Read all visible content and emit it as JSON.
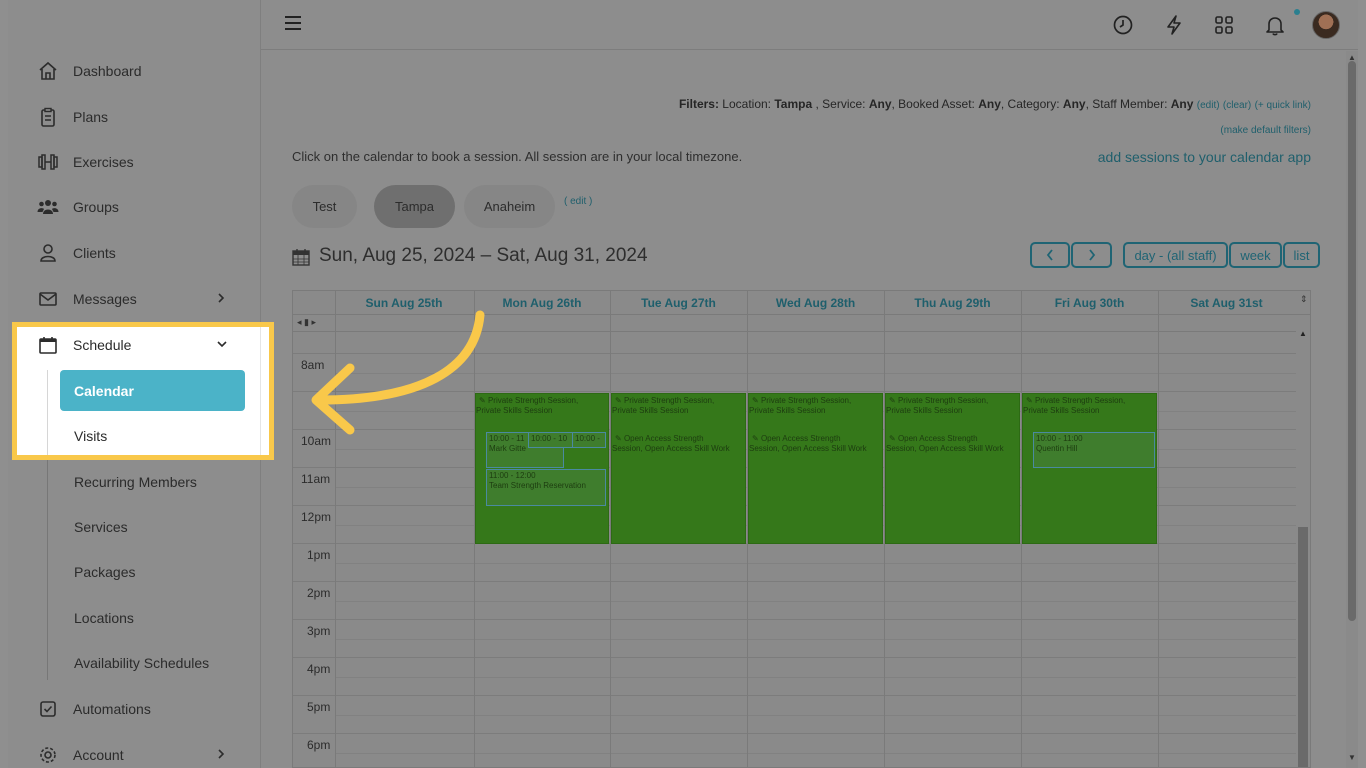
{
  "sidebar": {
    "items": [
      {
        "label": "Dashboard",
        "icon": "home-icon"
      },
      {
        "label": "Plans",
        "icon": "clipboard-icon"
      },
      {
        "label": "Exercises",
        "icon": "dumbbell-icon"
      },
      {
        "label": "Groups",
        "icon": "users-icon"
      },
      {
        "label": "Clients",
        "icon": "user-icon"
      },
      {
        "label": "Messages",
        "icon": "mail-icon"
      },
      {
        "label": "Schedule",
        "icon": "calendar-icon"
      },
      {
        "label": "Automations",
        "icon": "check-square-icon"
      },
      {
        "label": "Account",
        "icon": "gear-icon"
      }
    ],
    "schedule_sub": [
      "Calendar",
      "Visits",
      "Recurring Members",
      "Services",
      "Packages",
      "Locations",
      "Availability Schedules"
    ]
  },
  "filters": {
    "label": "Filters:",
    "location_label": " Location: ",
    "location_value": "Tampa",
    "service_label": " , Service: ",
    "service_value": "Any",
    "asset_label": ", Booked Asset: ",
    "asset_value": "Any",
    "category_label": ", Category: ",
    "category_value": "Any",
    "staff_label": ", Staff Member: ",
    "staff_value": "Any",
    "edit": "(edit)",
    "clear": "(clear)",
    "quick": "(+ quick link)",
    "make_default": "(make default filters)"
  },
  "info_line": "Click on the calendar to book a session. All session are in your local timezone.",
  "add_sessions": "add sessions to your calendar app",
  "locations": [
    "Test",
    "Tampa",
    "Anaheim"
  ],
  "locations_edit": "( edit )",
  "date_range": "Sun, Aug 25, 2024 – Sat, Aug 31, 2024",
  "buttons": {
    "prev": "‹",
    "next": "›",
    "day": "day - (all staff)",
    "week": "week",
    "list": "list"
  },
  "days": [
    "Sun Aug 25th",
    "Mon Aug 26th",
    "Tue Aug 27th",
    "Wed Aug 28th",
    "Thu Aug 29th",
    "Fri Aug 30th",
    "Sat Aug 31st"
  ],
  "hours": [
    "8am",
    "9am",
    "10am",
    "11am",
    "12pm",
    "1pm",
    "2pm",
    "3pm",
    "4pm",
    "5pm",
    "6pm"
  ],
  "events": {
    "private": "Private Strength Session, Private Skills Session",
    "private_a": "Private Strength Session,",
    "private_b": "Private Skills Session",
    "open_a": "Open Access Strength",
    "open_b": "Session, Open Access Skill Work",
    "mon_box1_time": "10:00 - 11",
    "mon_box1_name": "Mark Gitte",
    "mon_box2_time": "10:00 - 10",
    "mon_box3_time": "10:00 -",
    "mon_box4_time": "11:00 - 12:00",
    "mon_box4_name": "Team Strength Reservation",
    "fri_box_time": "10:00 - 11:00",
    "fri_box_name": "Quentin Hill"
  },
  "colors": {
    "accent": "#4bb3c8",
    "highlight": "#f9c84a",
    "event_green": "#35781a"
  }
}
